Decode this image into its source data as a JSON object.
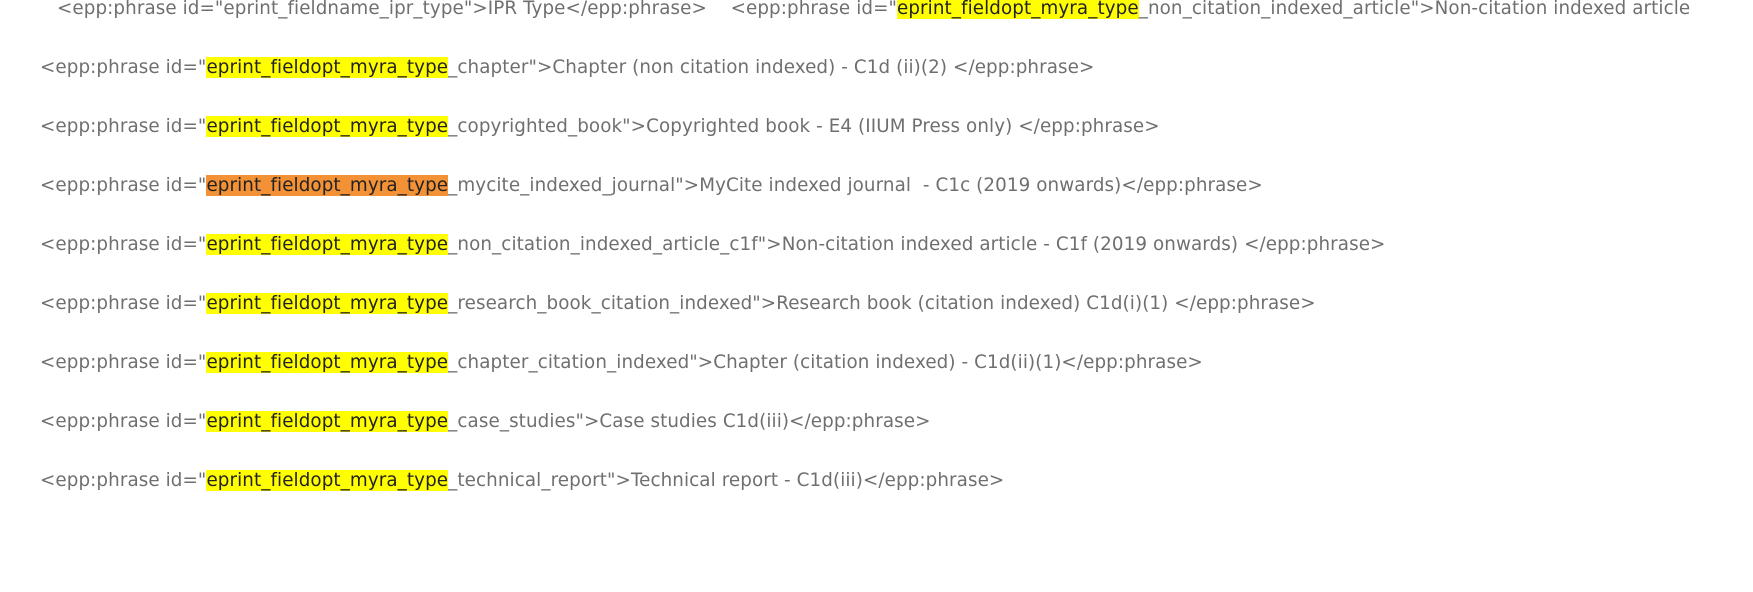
{
  "colors": {
    "text": "#6f6f6f",
    "match_highlight": "#ffff00",
    "current_match_highlight": "#f39137"
  },
  "lines": [
    {
      "parts": [
        "<epp:phrase id=\"eprint_fieldname_ipr_type\">IPR Type</epp:phrase>    <epp:phrase id=\"",
        "eprint_fieldopt_myra_type",
        "_non_citation_indexed_article\">Non-citation indexed article"
      ]
    },
    {
      "parts": [
        "<epp:phrase id=\"",
        "eprint_fieldopt_myra_type",
        "_chapter\">Chapter (non citation indexed) - C1d (ii)(2) </epp:phrase>"
      ]
    },
    {
      "parts": [
        "<epp:phrase id=\"",
        "eprint_fieldopt_myra_type",
        "_copyrighted_book\">Copyrighted book - E4 (IIUM Press only) </epp:phrase>"
      ]
    },
    {
      "parts": [
        "<epp:phrase id=\"",
        "eprint_fieldopt_myra_type",
        "_mycite_indexed_journal\">MyCite indexed journal  - C1c (2019 onwards)</epp:phrase>"
      ]
    },
    {
      "parts": [
        "<epp:phrase id=\"",
        "eprint_fieldopt_myra_type",
        "_non_citation_indexed_article_c1f\">Non-citation indexed article - C1f (2019 onwards) </epp:phrase>"
      ]
    },
    {
      "parts": [
        "<epp:phrase id=\"",
        "eprint_fieldopt_myra_type",
        "_research_book_citation_indexed\">Research book (citation indexed) C1d(i)(1) </epp:phrase>"
      ]
    },
    {
      "parts": [
        "<epp:phrase id=\"",
        "eprint_fieldopt_myra_type",
        "_chapter_citation_indexed\">Chapter (citation indexed) - C1d(ii)(1)</epp:phrase>"
      ]
    },
    {
      "parts": [
        "<epp:phrase id=\"",
        "eprint_fieldopt_myra_type",
        "_case_studies\">Case studies C1d(iii)</epp:phrase>"
      ]
    },
    {
      "parts": [
        "<epp:phrase id=\"",
        "eprint_fieldopt_myra_type",
        "_technical_report\">Technical report - C1d(iii)</epp:phrase>"
      ]
    }
  ]
}
